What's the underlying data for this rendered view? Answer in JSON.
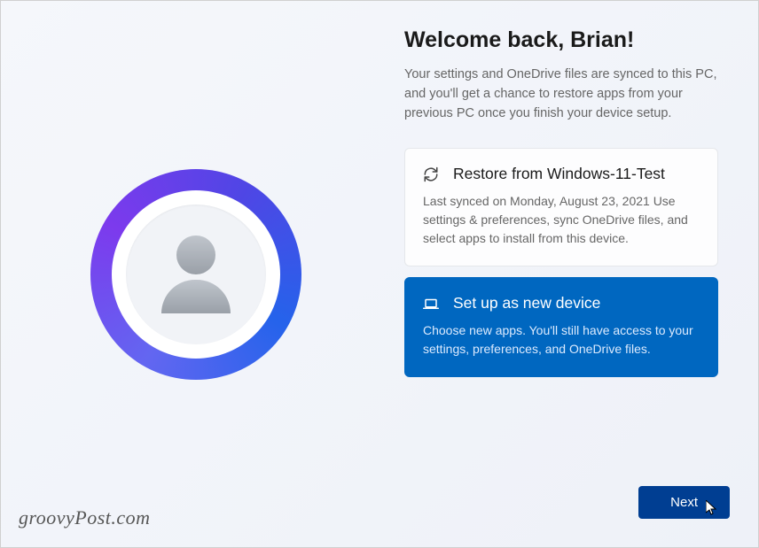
{
  "heading": "Welcome back, Brian!",
  "subheading": "Your settings and OneDrive files are synced to this PC, and you'll get a chance to restore apps from your previous PC once you finish your device setup.",
  "options": {
    "restore": {
      "title": "Restore from Windows-11-Test",
      "desc": "Last synced on Monday, August 23, 2021\nUse settings & preferences, sync OneDrive files, and select apps to install from this device."
    },
    "new_device": {
      "title": "Set up as new device",
      "desc": "Choose new apps. You'll still have access to your settings, preferences, and OneDrive files."
    }
  },
  "next_button": "Next",
  "watermark": "groovyPost.com"
}
